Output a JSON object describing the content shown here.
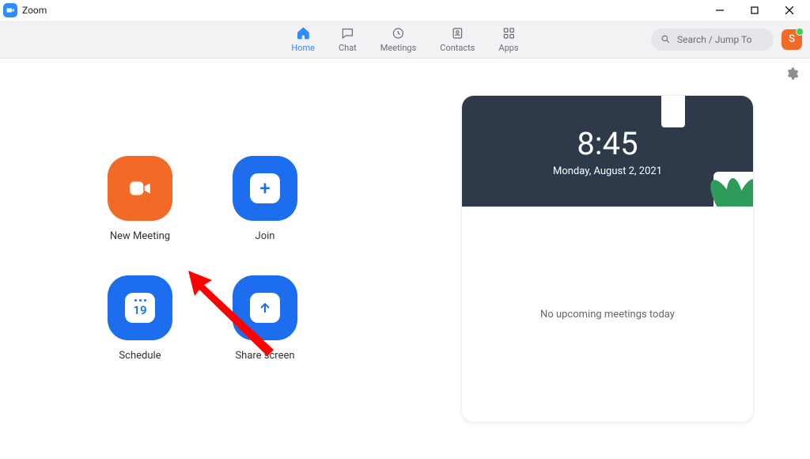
{
  "app": {
    "name": "Zoom"
  },
  "nav": {
    "tabs": [
      {
        "label": "Home"
      },
      {
        "label": "Chat"
      },
      {
        "label": "Meetings"
      },
      {
        "label": "Contacts"
      },
      {
        "label": "Apps"
      }
    ]
  },
  "search": {
    "placeholder": "Search / Jump To"
  },
  "avatar": {
    "initial": "S"
  },
  "actions": {
    "new_meeting": {
      "label": "New Meeting"
    },
    "join": {
      "label": "Join"
    },
    "schedule": {
      "label": "Schedule",
      "day_number": "19"
    },
    "share_screen": {
      "label": "Share screen"
    }
  },
  "clock": {
    "time": "8:45",
    "date": "Monday, August 2, 2021"
  },
  "meetings": {
    "empty_message": "No upcoming meetings today"
  }
}
